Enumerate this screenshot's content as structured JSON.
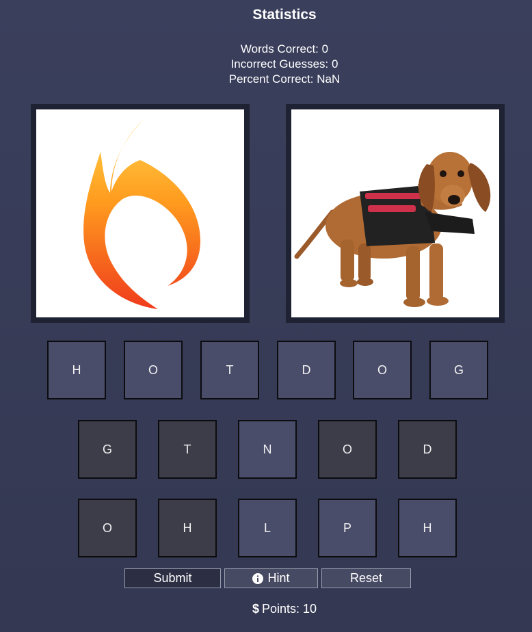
{
  "stats": {
    "title": "Statistics",
    "words_correct": "Words Correct: 0",
    "incorrect_guesses": "Incorrect Guesses: 0",
    "percent_correct": "Percent Correct: NaN"
  },
  "images": {
    "left": "flame-icon",
    "right": "dachshund-in-harness"
  },
  "answer_tiles": [
    "H",
    "O",
    "T",
    "D",
    "O",
    "G"
  ],
  "letter_rows": [
    [
      "G",
      "T",
      "N",
      "O",
      "D"
    ],
    [
      "O",
      "H",
      "L",
      "P",
      "H"
    ]
  ],
  "buttons": {
    "submit": "Submit",
    "hint": "Hint",
    "reset": "Reset"
  },
  "points": {
    "icon": "dollar-icon",
    "label": "Points: 10"
  },
  "colors": {
    "background": "#3a3f5c",
    "tile_light": "#4a4d6a",
    "tile_dark": "#3c3d49",
    "frame": "#1f2233"
  }
}
